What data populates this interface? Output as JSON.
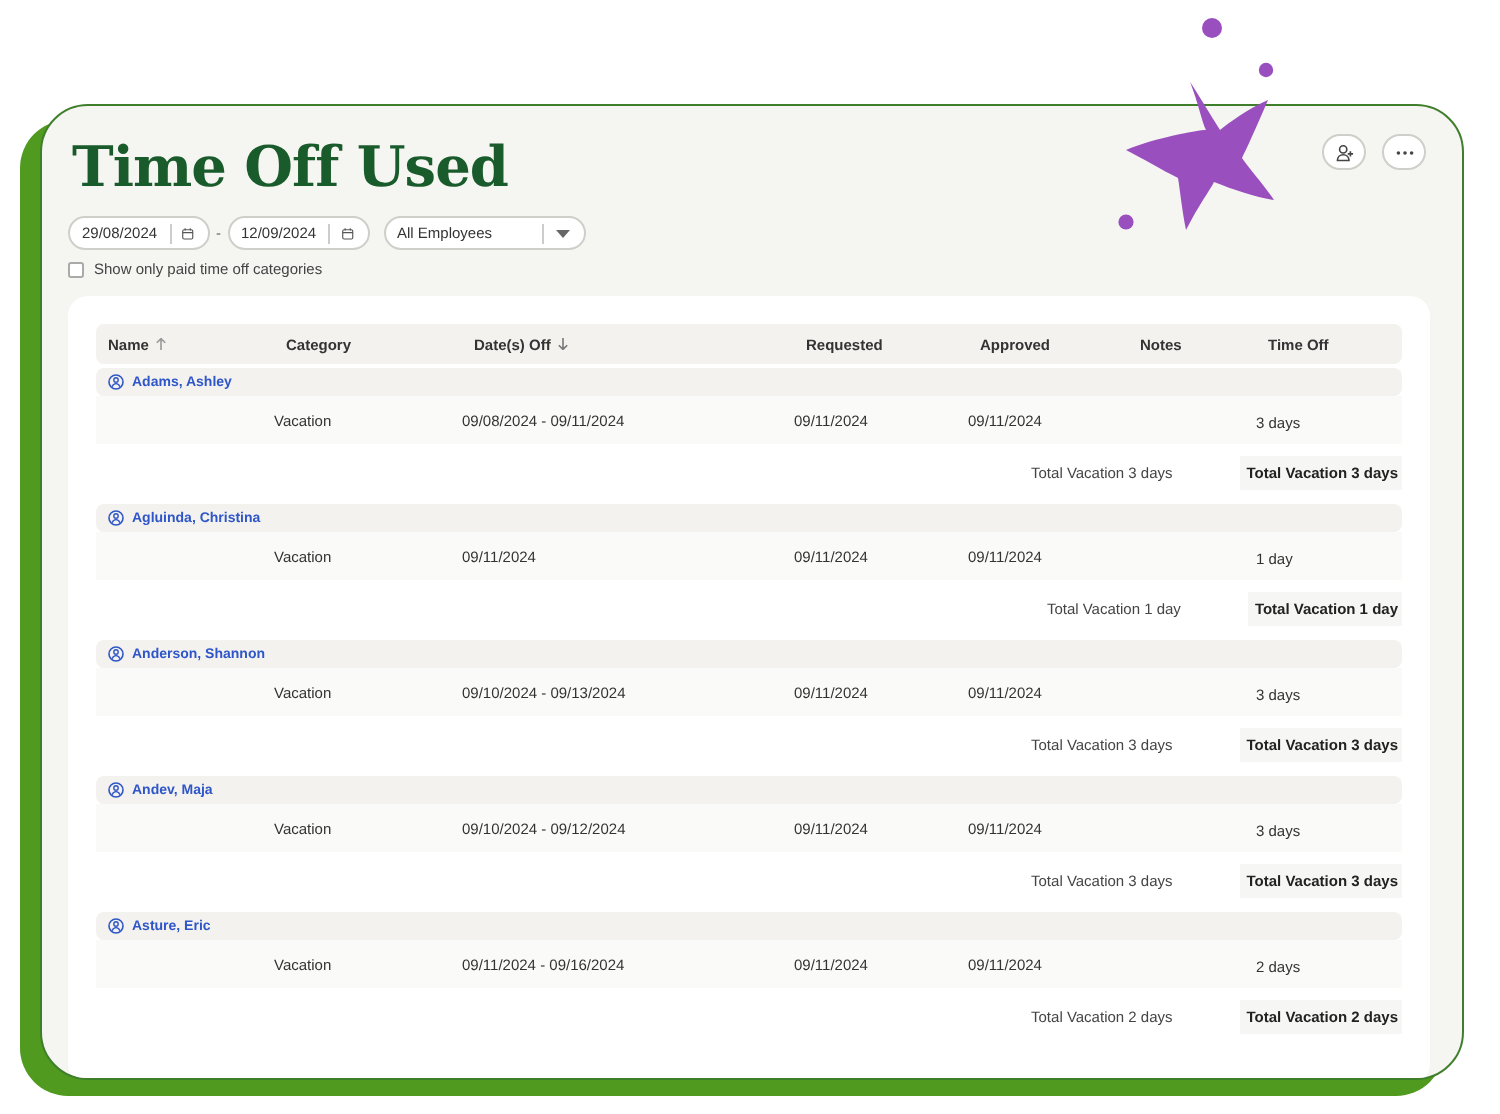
{
  "title": "Time Off Used",
  "filters": {
    "start_date": "29/08/2024",
    "range_separator": "-",
    "end_date": "12/09/2024",
    "employee_select": "All Employees",
    "paid_only": {
      "label": "Show only paid time off categories",
      "checked": false
    }
  },
  "table": {
    "columns": [
      {
        "label": "Name",
        "sorted": true,
        "descending": false
      },
      {
        "label": "Category"
      },
      {
        "label": "Date(s) Off",
        "sorted": true,
        "descending": true
      },
      {
        "label": "Requested"
      },
      {
        "label": "Approved"
      },
      {
        "label": "Notes"
      },
      {
        "label": "Time Off"
      }
    ],
    "groups": [
      {
        "employee": "Adams, Ashley",
        "rows": [
          {
            "category": "Vacation",
            "dates": "09/08/2024 - 09/11/2024",
            "requested": "09/11/2024",
            "approved": "09/11/2024",
            "time_off": "3 days"
          }
        ],
        "total_label": "Total Vacation 3 days",
        "total_value": "Total Vacation 3 days"
      },
      {
        "employee": "Agluinda, Christina",
        "rows": [
          {
            "category": "Vacation",
            "dates": "09/11/2024",
            "requested": "09/11/2024",
            "approved": "09/11/2024",
            "time_off": "1 day"
          }
        ],
        "total_label": "Total Vacation 1 day",
        "total_value": "Total Vacation 1 day"
      },
      {
        "employee": "Anderson, Shannon",
        "rows": [
          {
            "category": "Vacation",
            "dates": "09/10/2024 - 09/13/2024",
            "requested": "09/11/2024",
            "approved": "09/11/2024",
            "time_off": "3 days"
          }
        ],
        "total_label": "Total Vacation 3 days",
        "total_value": "Total Vacation 3 days"
      },
      {
        "employee": "Andev, Maja",
        "rows": [
          {
            "category": "Vacation",
            "dates": "09/10/2024 - 09/12/2024",
            "requested": "09/11/2024",
            "approved": "09/11/2024",
            "time_off": "3 days"
          }
        ],
        "total_label": "Total Vacation 3 days",
        "total_value": "Total Vacation 3 days"
      },
      {
        "employee": "Asture, Eric",
        "rows": [
          {
            "category": "Vacation",
            "dates": "09/11/2024 - 09/16/2024",
            "requested": "09/11/2024",
            "approved": "09/11/2024",
            "time_off": "2 days"
          }
        ],
        "total_label": "Total Vacation 2 days",
        "total_value": "Total Vacation 2 days"
      }
    ]
  }
}
